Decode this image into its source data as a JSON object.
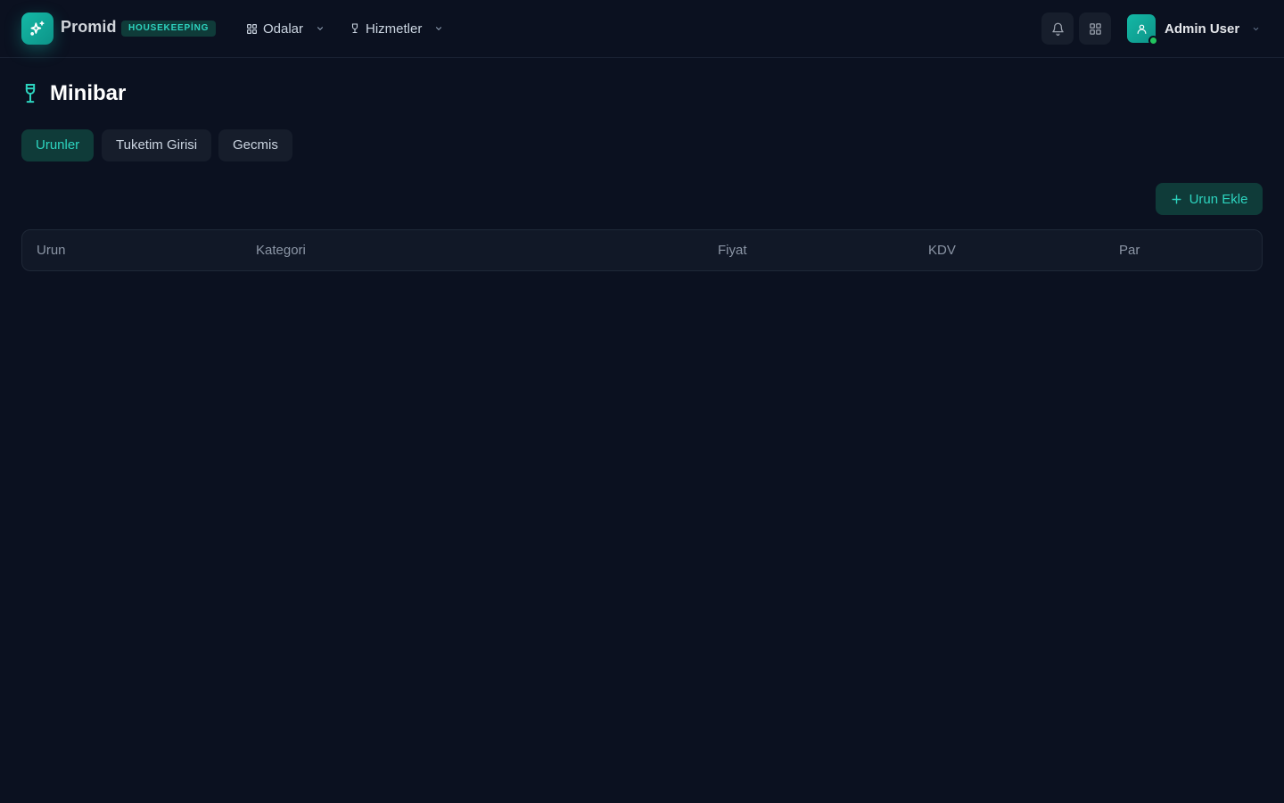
{
  "header": {
    "brand_name": "Promid",
    "brand_badge": "HOUSEKEEPİNG",
    "nav": [
      {
        "label": "Odalar",
        "icon": "grid-icon"
      },
      {
        "label": "Hizmetler",
        "icon": "wine-glass-icon"
      }
    ],
    "user_name": "Admin User",
    "user_status": "online"
  },
  "page": {
    "title": "Minibar",
    "title_icon": "wine-glass-icon",
    "tabs": [
      {
        "label": "Urunler",
        "active": true
      },
      {
        "label": "Tuketim Girisi",
        "active": false
      },
      {
        "label": "Gecmis",
        "active": false
      }
    ],
    "add_button_label": "Urun Ekle"
  },
  "table": {
    "columns": [
      "Urun",
      "Kategori",
      "Fiyat",
      "KDV",
      "Par"
    ],
    "rows": []
  },
  "colors": {
    "background": "#0b1120",
    "accent": "#2dd4bf",
    "accent_bg": "#0f3b39",
    "online": "#22c55e"
  }
}
